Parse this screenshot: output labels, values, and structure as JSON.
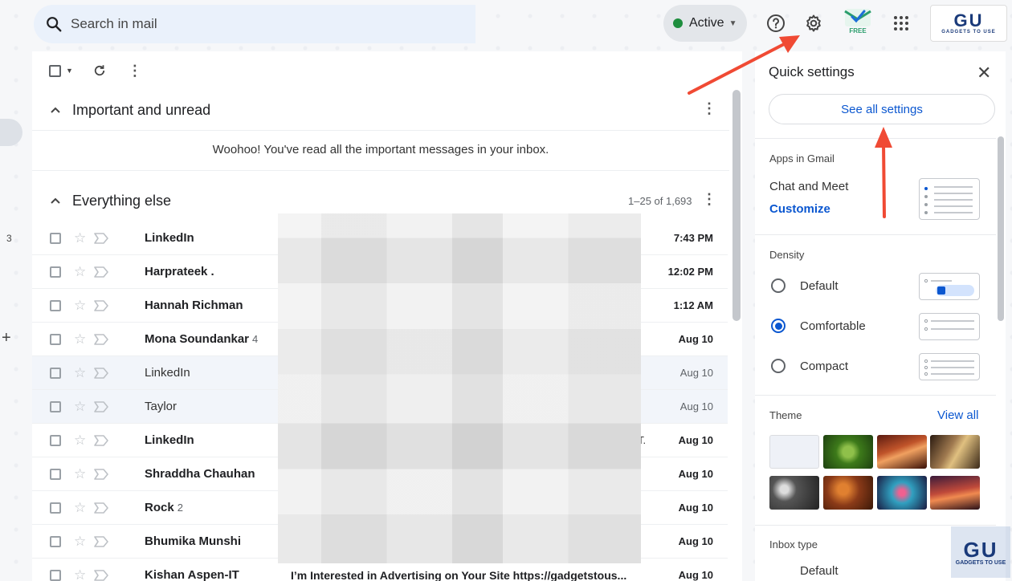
{
  "search": {
    "placeholder": "Search in mail"
  },
  "status": {
    "label": "Active",
    "color": "#1e8e3e"
  },
  "header_icons": [
    "help-icon",
    "gear-icon",
    "extension-icon",
    "apps-grid-icon"
  ],
  "extension": {
    "badge": "FREE"
  },
  "brand_logo": {
    "text": "GU",
    "tagline": "GADGETS TO USE"
  },
  "left_rail": {
    "count": "3"
  },
  "sections": {
    "important": {
      "title": "Important and unread",
      "empty_message": "Woohoo! You've read all the important messages in your inbox."
    },
    "everything": {
      "title": "Everything else",
      "page_count": "1–25 of 1,693"
    }
  },
  "emails": [
    {
      "sender": "LinkedIn",
      "count": "",
      "time": "7:43 PM",
      "tail": ".",
      "read": false
    },
    {
      "sender": "Harprateek .",
      "count": "",
      "time": "12:02 PM",
      "tail": "",
      "read": false
    },
    {
      "sender": "Hannah Richman",
      "count": "",
      "time": "1:12 AM",
      "tail": "",
      "read": false
    },
    {
      "sender": "Mona Soundankar",
      "count": "4",
      "time": "Aug 10",
      "tail": "",
      "read": false
    },
    {
      "sender": "LinkedIn",
      "count": "",
      "time": "Aug 10",
      "tail": ".",
      "read": true
    },
    {
      "sender": "Taylor",
      "count": "",
      "time": "Aug 10",
      "tail": "",
      "read": true
    },
    {
      "sender": "LinkedIn",
      "count": "",
      "time": "Aug 10",
      "tail": "T.",
      "read": false
    },
    {
      "sender": "Shraddha Chauhan",
      "count": "",
      "time": "Aug 10",
      "tail": "",
      "read": false
    },
    {
      "sender": "Rock",
      "count": "2",
      "time": "Aug 10",
      "tail": "",
      "read": false
    },
    {
      "sender": "Bhumika Munshi",
      "count": "",
      "time": "Aug 10",
      "tail": "",
      "read": false
    },
    {
      "sender": "Kishan Aspen-IT",
      "count": "",
      "time": "Aug 10",
      "tail": "",
      "read": false,
      "subject": "I’m Interested in Advertising on Your Site https://gadgetstous..."
    }
  ],
  "quick_settings": {
    "title": "Quick settings",
    "see_all": "See all settings",
    "apps_label": "Apps in Gmail",
    "apps_value": "Chat and Meet",
    "customize": "Customize",
    "density_label": "Density",
    "density_options": [
      {
        "label": "Default",
        "selected": false
      },
      {
        "label": "Comfortable",
        "selected": true
      },
      {
        "label": "Compact",
        "selected": false
      }
    ],
    "theme_label": "Theme",
    "view_all": "View all",
    "inbox_type_label": "Inbox type",
    "inbox_type_value": "Default"
  },
  "accent_color": "#0b57d0",
  "arrow_color": "#f04a34"
}
